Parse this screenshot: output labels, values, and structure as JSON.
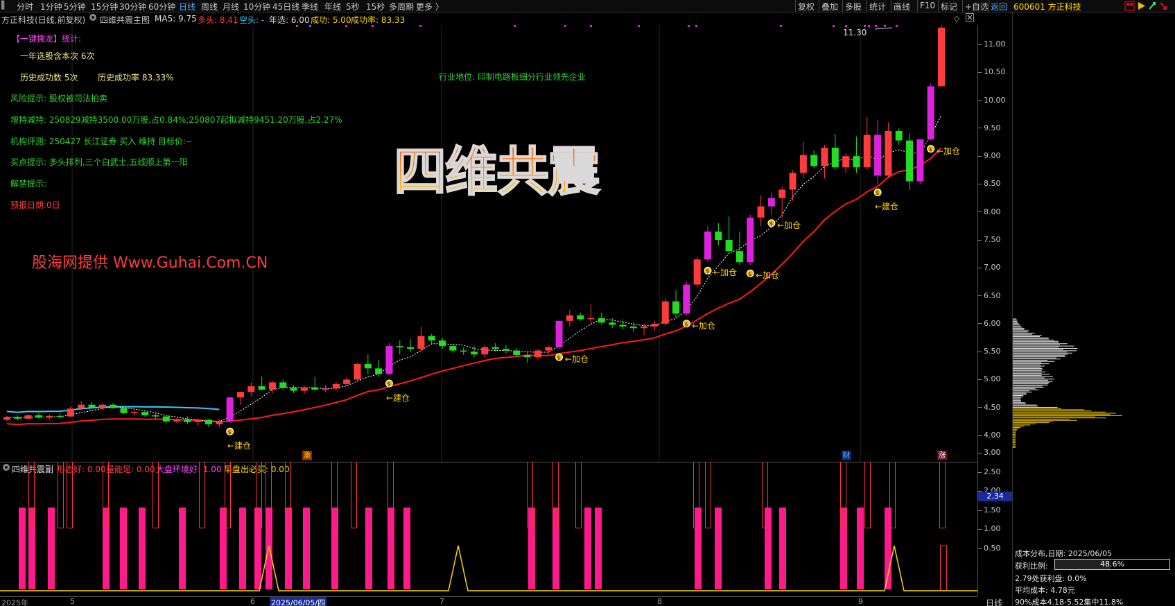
{
  "top_menu": {
    "periods": [
      "分时",
      "1分钟",
      "5分钟",
      "15分钟",
      "30分钟",
      "60分钟",
      "日线",
      "周线",
      "月线",
      "10分钟",
      "45日线",
      "季线",
      "年线",
      "5秒",
      "15秒",
      "多周期",
      "更多 〉"
    ],
    "active": "日线",
    "right_buttons": [
      "复权",
      "叠加",
      "多股",
      "统计",
      "画线",
      "F10",
      "标记",
      "+自选",
      "返回"
    ],
    "stock_code_name": "600601 方正科技"
  },
  "title_bar": {
    "stock": "方正科技(日线,前复权)",
    "indicator": "四维共震主图",
    "ma5": "MA5: 9.75",
    "duotou": "多头: 8.41",
    "kongtou": "空头: -",
    "nianxuan": "年选: 6.00",
    "chenggong": "成功: 5.00",
    "chenggonglv": "成功率: 83.33"
  },
  "stats": {
    "header": "【一键擒龙】统计:",
    "yearly_picks": "一年选股含本次 6次",
    "success_count": "历史成功数 5次",
    "success_rate": "历史成功率 83.33%",
    "industry": "行业地位: 印制电路板细分行业领先企业",
    "risk": "风险提示: 股权被司法拍卖",
    "holdings_change": "增持减持: 250829减持3500.00万股,占0.84%;250807起拟减持9451.20万股,占2.27%",
    "rating": "机构评测: 250427 长江证券 买入 维持 目标价:--",
    "buy_point": "买点提示: 多头排列,三个白武士,五线顺上第一阳",
    "unlock": "解禁提示:",
    "forecast": "预报日期:0日"
  },
  "big_title": "四维共震",
  "watermark": "股海网提供 Www.Guhai.Com.CN",
  "max_price_label": "11.30",
  "markers": {
    "jiancang": "←建仓",
    "jiacang": "←加仓"
  },
  "bottom_flags": {
    "ji": "激",
    "cai": "财",
    "zhang": "涨"
  },
  "sub_title": {
    "name": "四维共震副",
    "xingtai": "形态好: 0.00",
    "liangneng": "量能足: 0.00",
    "dapan": "大盘环境好: 1.00",
    "zaopan": "早盘出必买: 0.00"
  },
  "sub_value_badge": "2.34",
  "price_axis": [
    "11.00",
    "10.50",
    "10.00",
    "9.50",
    "9.00",
    "8.50",
    "8.00",
    "7.50",
    "7.00",
    "6.50",
    "6.00",
    "5.50",
    "5.00",
    "4.50",
    "4.00"
  ],
  "sub_axis": [
    "3.00",
    "2.50",
    "2.00",
    "1.50",
    "1.00",
    "0.50"
  ],
  "date_axis": [
    "2025年",
    "5",
    "6",
    "2025/06/05/四",
    "7",
    "8",
    "9"
  ],
  "period_label": "日线",
  "cost_panel": {
    "title": "成本分布,日期: 2025/06/05",
    "profit_ratio_label": "获利比例:",
    "profit_ratio": "48.6%",
    "profit_ratio_value": 0.486,
    "profit_at": "2.79处获利盘: 0.0%",
    "avg_cost": "平均成本: 4.78元",
    "concentration": "90%成本4.18-5.52集中11.8%"
  },
  "colors": {
    "up": "#ff3b3b",
    "down": "#22dd22",
    "signal": "#dd22dd",
    "ma_red": "#ff1a1a",
    "ma_cyan": "#33ccff",
    "accent": "#ffd700"
  },
  "chart_data": {
    "type": "candlestick",
    "y_range": [
      3.6,
      11.6
    ],
    "ohlc": [
      [
        4.28,
        4.35,
        4.25,
        4.33
      ],
      [
        4.33,
        4.36,
        4.27,
        4.3
      ],
      [
        4.3,
        4.38,
        4.28,
        4.36
      ],
      [
        4.36,
        4.4,
        4.3,
        4.32
      ],
      [
        4.32,
        4.38,
        4.28,
        4.35
      ],
      [
        4.35,
        4.4,
        4.3,
        4.34
      ],
      [
        4.34,
        4.52,
        4.32,
        4.48
      ],
      [
        4.48,
        4.62,
        4.45,
        4.55
      ],
      [
        4.55,
        4.6,
        4.48,
        4.5
      ],
      [
        4.5,
        4.58,
        4.46,
        4.55
      ],
      [
        4.55,
        4.58,
        4.48,
        4.49
      ],
      [
        4.49,
        4.52,
        4.38,
        4.4
      ],
      [
        4.4,
        4.45,
        4.35,
        4.42
      ],
      [
        4.42,
        4.44,
        4.33,
        4.36
      ],
      [
        4.36,
        4.4,
        4.3,
        4.34
      ],
      [
        4.34,
        4.36,
        4.22,
        4.25
      ],
      [
        4.25,
        4.32,
        4.22,
        4.28
      ],
      [
        4.28,
        4.34,
        4.2,
        4.24
      ],
      [
        4.24,
        4.3,
        4.18,
        4.28
      ],
      [
        4.28,
        4.3,
        4.15,
        4.2
      ],
      [
        4.2,
        4.28,
        4.15,
        4.25
      ],
      [
        4.25,
        4.7,
        4.22,
        4.68
      ],
      [
        4.68,
        4.75,
        4.55,
        4.78
      ],
      [
        4.78,
        4.95,
        4.7,
        4.88
      ],
      [
        4.88,
        5.05,
        4.8,
        4.82
      ],
      [
        4.82,
        4.98,
        4.75,
        4.95
      ],
      [
        4.95,
        5.0,
        4.82,
        4.85
      ],
      [
        4.85,
        4.9,
        4.76,
        4.8
      ],
      [
        4.8,
        4.9,
        4.74,
        4.86
      ],
      [
        4.86,
        5.05,
        4.8,
        4.82
      ],
      [
        4.82,
        4.9,
        4.78,
        4.84
      ],
      [
        4.84,
        4.96,
        4.8,
        4.92
      ],
      [
        4.92,
        5.05,
        4.88,
        5.0
      ],
      [
        5.0,
        5.3,
        4.96,
        5.28
      ],
      [
        5.28,
        5.45,
        5.1,
        5.2
      ],
      [
        5.2,
        5.35,
        5.05,
        5.1
      ],
      [
        5.1,
        5.65,
        5.08,
        5.6
      ],
      [
        5.6,
        5.7,
        5.45,
        5.58
      ],
      [
        5.58,
        5.72,
        5.5,
        5.55
      ],
      [
        5.55,
        5.95,
        5.5,
        5.78
      ],
      [
        5.78,
        5.82,
        5.62,
        5.7
      ],
      [
        5.7,
        5.75,
        5.55,
        5.6
      ],
      [
        5.6,
        5.62,
        5.48,
        5.52
      ],
      [
        5.52,
        5.58,
        5.44,
        5.5
      ],
      [
        5.5,
        5.6,
        5.4,
        5.45
      ],
      [
        5.45,
        5.62,
        5.4,
        5.58
      ],
      [
        5.58,
        5.65,
        5.5,
        5.55
      ],
      [
        5.55,
        5.62,
        5.46,
        5.52
      ],
      [
        5.52,
        5.56,
        5.4,
        5.44
      ],
      [
        5.44,
        5.5,
        5.3,
        5.4
      ],
      [
        5.4,
        5.55,
        5.36,
        5.52
      ],
      [
        5.52,
        5.6,
        5.45,
        5.58
      ],
      [
        5.58,
        6.05,
        5.55,
        6.05
      ],
      [
        6.05,
        6.25,
        5.95,
        6.15
      ],
      [
        6.15,
        6.2,
        6.05,
        6.08
      ],
      [
        6.08,
        6.35,
        6.0,
        6.1
      ],
      [
        6.1,
        6.2,
        5.98,
        6.02
      ],
      [
        6.02,
        6.1,
        5.92,
        5.98
      ],
      [
        5.98,
        6.08,
        5.9,
        5.95
      ],
      [
        5.95,
        6.02,
        5.85,
        5.92
      ],
      [
        5.92,
        6.0,
        5.8,
        5.95
      ],
      [
        5.95,
        6.05,
        5.88,
        6.0
      ],
      [
        6.0,
        6.45,
        5.96,
        6.4
      ],
      [
        6.4,
        6.6,
        6.1,
        6.18
      ],
      [
        6.18,
        6.75,
        6.15,
        6.7
      ],
      [
        6.7,
        7.2,
        6.65,
        7.15
      ],
      [
        7.15,
        7.75,
        7.1,
        7.65
      ],
      [
        7.65,
        7.8,
        7.4,
        7.5
      ],
      [
        7.5,
        7.92,
        7.25,
        7.3
      ],
      [
        7.3,
        7.65,
        7.05,
        7.1
      ],
      [
        7.1,
        7.95,
        7.05,
        7.9
      ],
      [
        7.9,
        8.3,
        7.75,
        8.1
      ],
      [
        8.1,
        8.35,
        7.95,
        8.25
      ],
      [
        8.25,
        8.45,
        7.9,
        8.4
      ],
      [
        8.4,
        8.75,
        8.2,
        8.7
      ],
      [
        8.7,
        9.25,
        8.6,
        9.02
      ],
      [
        9.02,
        9.1,
        8.78,
        8.82
      ],
      [
        8.82,
        9.2,
        8.6,
        9.15
      ],
      [
        9.15,
        9.4,
        8.75,
        8.8
      ],
      [
        8.8,
        9.05,
        8.7,
        9.0
      ],
      [
        9.0,
        9.35,
        8.7,
        8.8
      ],
      [
        8.8,
        9.7,
        8.75,
        9.38
      ],
      [
        9.38,
        9.65,
        8.5,
        8.65
      ],
      [
        8.65,
        9.6,
        8.6,
        9.45
      ],
      [
        9.45,
        9.5,
        9.2,
        9.28
      ],
      [
        9.28,
        9.4,
        8.4,
        8.55
      ],
      [
        8.55,
        9.25,
        8.5,
        9.3
      ],
      [
        9.3,
        10.3,
        9.28,
        10.25
      ],
      [
        10.25,
        11.35,
        10.4,
        11.3
      ]
    ]
  }
}
